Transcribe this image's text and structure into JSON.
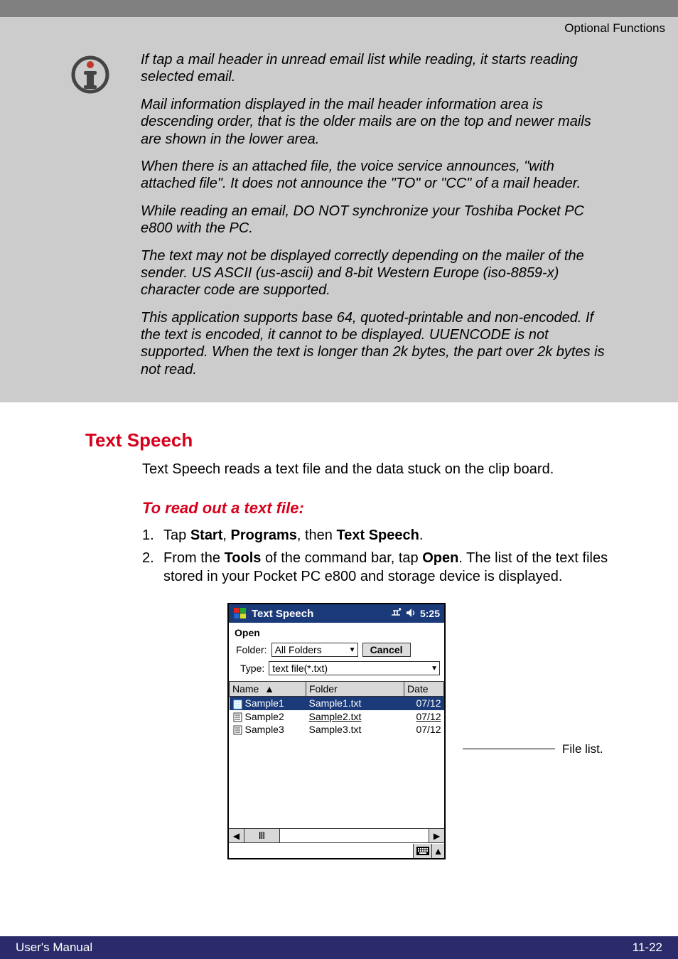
{
  "header": {
    "right": "Optional Functions"
  },
  "note": {
    "paras": [
      "If tap a mail header in unread email list while reading, it starts reading selected email.",
      "Mail information displayed in the mail header information area is descending order, that is the older mails are on the top and newer mails are shown in the lower area.",
      "When there is an attached file, the voice service announces, \"with attached file\". It does not announce the \"TO\" or \"CC\" of a mail header.",
      "While reading an email, DO NOT synchronize your Toshiba Pocket PC e800 with the PC.",
      "The text may not be displayed correctly depending on the mailer of the sender. US ASCII (us-ascii) and 8-bit Western Europe (iso-8859-x) character code are supported.",
      "This application supports base 64, quoted-printable and non-encoded. If the text is encoded, it cannot to be displayed. UUENCODE is not supported. When the text is longer than 2k bytes, the part over 2k bytes is not read."
    ]
  },
  "section": {
    "title": "Text Speech",
    "intro": "Text Speech reads a text file and the data stuck on the clip board.",
    "sub": "To read out a text file:",
    "steps": [
      {
        "n": "1.",
        "pre": "Tap ",
        "b1": "Start",
        "m1": ", ",
        "b2": "Programs",
        "m2": ", then ",
        "b3": "Text Speech",
        "post": "."
      },
      {
        "n": "2.",
        "pre": "From the ",
        "b1": "Tools",
        "m1": " of the command bar, tap ",
        "b2": "Open",
        "m2": ". The list of the text files stored in your Pocket PC e800 and storage device is displayed.",
        "b3": "",
        "post": ""
      }
    ]
  },
  "screenshot": {
    "title": "Text Speech",
    "time": "5:25",
    "open": "Open",
    "folder_label": "Folder:",
    "folder_value": "All Folders",
    "cancel": "Cancel",
    "type_label": "Type:",
    "type_value": "text file(*.txt)",
    "cols": {
      "name": "Name",
      "folder": "Folder",
      "date": "Date",
      "sort": "▲"
    },
    "rows": [
      {
        "name": "Sample1",
        "folder": "Sample1.txt",
        "date": "07/12",
        "sel": true
      },
      {
        "name": "Sample2",
        "folder": "Sample2.txt",
        "date": "07/12",
        "sel": false,
        "underline": true
      },
      {
        "name": "Sample3",
        "folder": "Sample3.txt",
        "date": "07/12",
        "sel": false
      }
    ],
    "thumb_glyph": "Ⅲ"
  },
  "callout": "File list.",
  "footer": {
    "left": "User's Manual",
    "right": "11-22"
  }
}
